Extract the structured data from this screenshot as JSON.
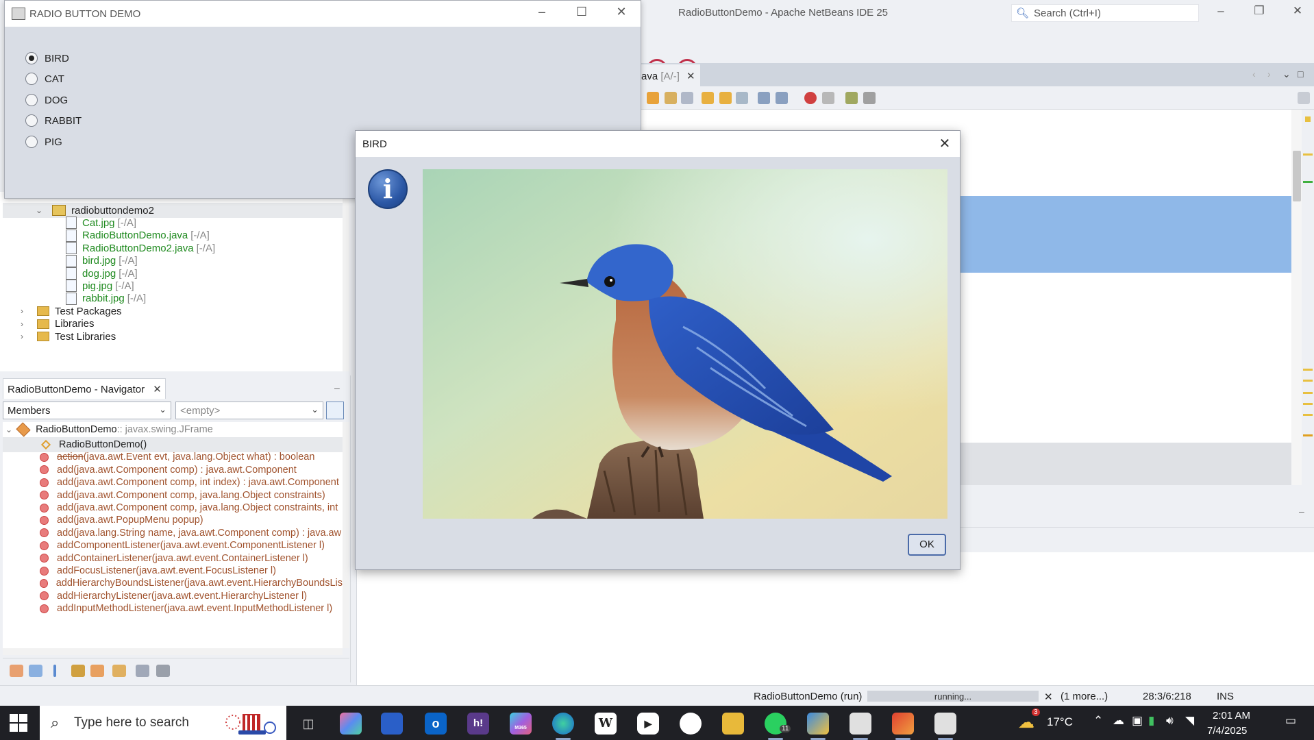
{
  "ide": {
    "title": "RadioButtonDemo - Apache NetBeans IDE 25",
    "search_placeholder": "Search (Ctrl+I)",
    "editor_tab": {
      "label": "ava",
      "status": "[A/-]"
    },
    "project_tree": [
      {
        "label": "radiobuttondemo2",
        "kind": "package",
        "indent": 2
      },
      {
        "label": "Cat.jpg",
        "status": "[-/A]",
        "kind": "file",
        "indent": 3
      },
      {
        "label": "RadioButtonDemo.java",
        "status": "[-/A]",
        "kind": "file",
        "indent": 3
      },
      {
        "label": "RadioButtonDemo2.java",
        "status": "[-/A]",
        "kind": "file",
        "indent": 3
      },
      {
        "label": "bird.jpg",
        "status": "[-/A]",
        "kind": "file",
        "indent": 3
      },
      {
        "label": "dog.jpg",
        "status": "[-/A]",
        "kind": "file",
        "indent": 3
      },
      {
        "label": "pig.jpg",
        "status": "[-/A]",
        "kind": "file",
        "indent": 3
      },
      {
        "label": "rabbit.jpg",
        "status": "[-/A]",
        "kind": "file",
        "indent": 3
      },
      {
        "label": "Test Packages",
        "kind": "folder",
        "indent": 1
      },
      {
        "label": "Libraries",
        "kind": "folder",
        "indent": 1
      },
      {
        "label": "Test Libraries",
        "kind": "folder",
        "indent": 1
      }
    ],
    "navigator": {
      "tab_label": "RadioButtonDemo - Navigator",
      "members_select": "Members",
      "empty_select": "<empty>",
      "root": {
        "name": "RadioButtonDemo",
        "type": " :: javax.swing.JFrame"
      },
      "items": [
        {
          "label": "RadioButtonDemo()",
          "kind": "constructor"
        },
        {
          "label": "action",
          "suffix": "(java.awt.Event evt, java.lang.Object what) : boolean",
          "kind": "deprecated"
        },
        {
          "label": "add(java.awt.Component comp) : java.awt.Component",
          "kind": "method"
        },
        {
          "label": "add(java.awt.Component comp, int index) : java.awt.Component",
          "kind": "method"
        },
        {
          "label": "add(java.awt.Component comp, java.lang.Object constraints)",
          "kind": "method"
        },
        {
          "label": "add(java.awt.Component comp, java.lang.Object constraints, int",
          "kind": "method"
        },
        {
          "label": "add(java.awt.PopupMenu popup)",
          "kind": "method"
        },
        {
          "label": "add(java.lang.String name, java.awt.Component comp) : java.aw",
          "kind": "method"
        },
        {
          "label": "addComponentListener(java.awt.event.ComponentListener l)",
          "kind": "method"
        },
        {
          "label": "addContainerListener(java.awt.event.ContainerListener l)",
          "kind": "method"
        },
        {
          "label": "addFocusListener(java.awt.event.FocusListener l)",
          "kind": "method"
        },
        {
          "label": "addHierarchyBoundsListener(java.awt.event.HierarchyBoundsLis",
          "kind": "method"
        },
        {
          "label": "addHierarchyListener(java.awt.event.HierarchyListener l)",
          "kind": "method"
        },
        {
          "label": "addInputMethodListener(java.awt.event.InputMethodListener l)",
          "kind": "method"
        }
      ]
    },
    "status": {
      "run_label": "RadioButtonDemo (run)",
      "progress_label": "running...",
      "more": "(1 more...)",
      "position": "28:3/6:218",
      "mode": "INS"
    }
  },
  "radio_window": {
    "title": "RADIO BUTTON DEMO",
    "options": [
      {
        "label": "BIRD",
        "selected": true
      },
      {
        "label": "CAT",
        "selected": false
      },
      {
        "label": "DOG",
        "selected": false
      },
      {
        "label": "RABBIT",
        "selected": false
      },
      {
        "label": "PIG",
        "selected": false
      }
    ]
  },
  "dialog": {
    "title": "BIRD",
    "ok_label": "OK",
    "close_glyph": "✕",
    "info_glyph": "i"
  },
  "taskbar": {
    "search_placeholder": "Type here to search",
    "weather": "17°C",
    "weather_badge": "3",
    "time": "2:01 AM",
    "date": "7/4/2025",
    "whatsapp_badge": "11",
    "hey_label": "h!",
    "wiki_label": "W",
    "m365_label": "M365"
  },
  "colors": {
    "accent": "#2b57a5",
    "selection": "#8fb8e8",
    "file_text": "#1f8a1f",
    "method_text": "#a0522d"
  }
}
